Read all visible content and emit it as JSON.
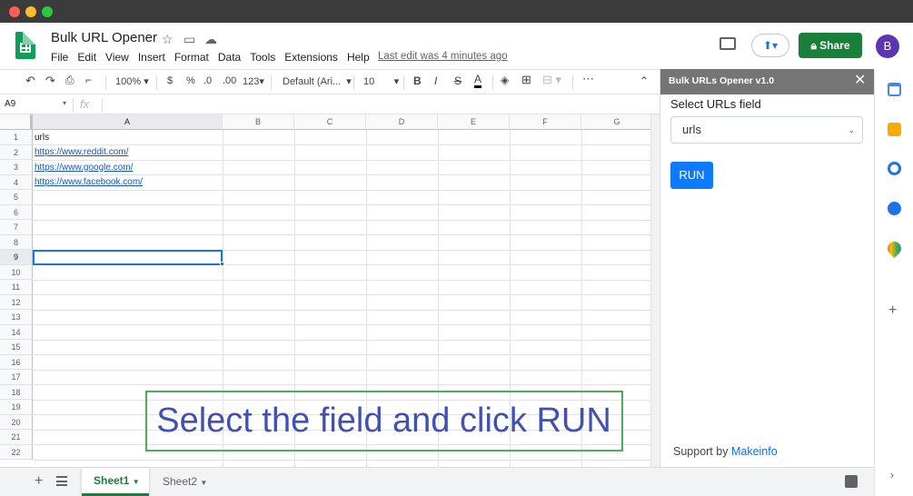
{
  "window": {
    "controls": [
      "close",
      "minimize",
      "zoom"
    ]
  },
  "app": {
    "doc_title": "Bulk URL Opener",
    "menu": [
      "File",
      "Edit",
      "View",
      "Insert",
      "Format",
      "Data",
      "Tools",
      "Extensions",
      "Help"
    ],
    "last_edit": "Last edit was 4 minutes ago",
    "share_label": "Share",
    "avatar_letter": "B"
  },
  "toolbar": {
    "zoom": "100%",
    "currency": "$",
    "percent": "%",
    "dec_less": ".0",
    "dec_more": ".00",
    "format_more": "123",
    "font": "Default (Ari...",
    "font_size": "10",
    "bold": "B",
    "italic": "I",
    "strike": "S",
    "text_color": "A",
    "more": "⋯"
  },
  "formula_bar": {
    "cell_ref": "A9",
    "fx": "fx",
    "content": ""
  },
  "grid": {
    "columns": [
      "A",
      "B",
      "C",
      "D",
      "E",
      "F",
      "G"
    ],
    "rows": [
      "1",
      "2",
      "3",
      "4",
      "5",
      "6",
      "7",
      "8",
      "9",
      "10",
      "11",
      "12",
      "13",
      "14",
      "15",
      "16",
      "17",
      "18",
      "19",
      "20",
      "21",
      "22"
    ],
    "selected_cell": "A9",
    "cells": [
      {
        "row": 1,
        "text": "urls",
        "link": false
      },
      {
        "row": 2,
        "text": "https://www.reddit.com/",
        "link": true
      },
      {
        "row": 3,
        "text": "https://www.google.com/",
        "link": true
      },
      {
        "row": 4,
        "text": "https://www.facebook.com/",
        "link": true
      }
    ]
  },
  "sheet_tabs": [
    {
      "label": "Sheet1",
      "active": true
    },
    {
      "label": "Sheet2",
      "active": false
    }
  ],
  "sidebar": {
    "title": "Bulk URLs Opener v1.0",
    "field_label": "Select URLs field",
    "selected_field": "urls",
    "run_label": "RUN",
    "support_prefix": "Support by",
    "support_link": "Makeinfo"
  },
  "overlay_caption": "Select the field and click RUN",
  "colors": {
    "brand_green": "#188038",
    "link_blue": "#1155cc",
    "run_blue": "#0d7bff",
    "caption_blue": "#3f51b5",
    "caption_border": "#4caf50"
  }
}
